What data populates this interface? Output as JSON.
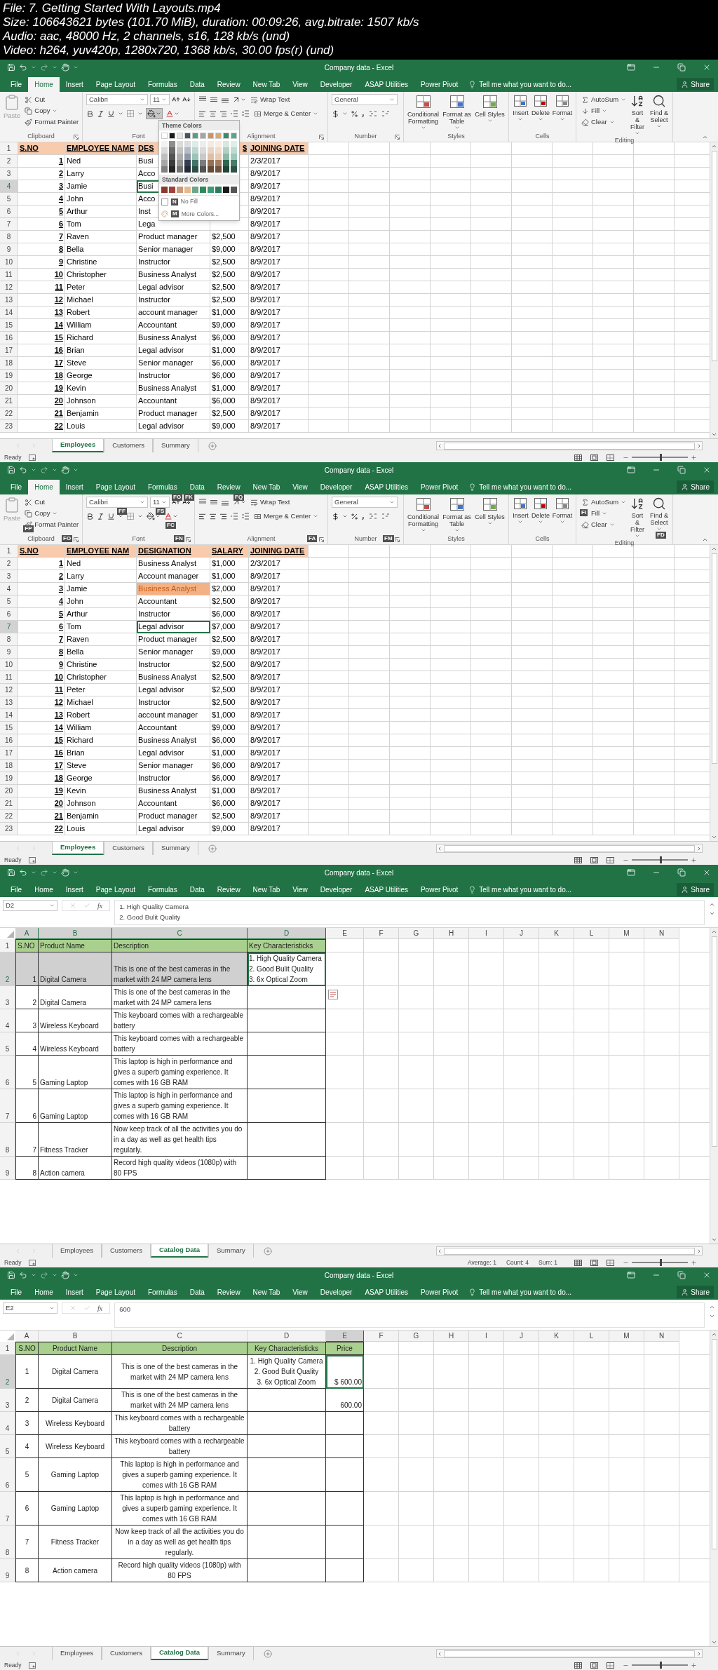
{
  "file_info": [
    "File: 7. Getting Started With Layouts.mp4",
    "Size: 106643621 bytes (101.70 MiB), duration: 00:09:26, avg.bitrate: 1507 kb/s",
    "Audio: aac, 48000 Hz, 2 channels, s16, 128 kb/s (und)",
    "Video: h264, yuv420p, 1280x720, 1368 kb/s, 30.00 fps(r) (und)"
  ],
  "frames": [
    {
      "title": "Company data - Excel",
      "menu_tabs": [
        {
          "label": "File",
          "selected": false
        },
        {
          "label": "Home",
          "selected": true
        },
        {
          "label": "Insert",
          "selected": false
        },
        {
          "label": "Page Layout",
          "selected": false
        },
        {
          "label": "Formulas",
          "selected": false
        },
        {
          "label": "Data",
          "selected": false
        },
        {
          "label": "Review",
          "selected": false
        },
        {
          "label": "New Tab",
          "selected": false
        },
        {
          "label": "View",
          "selected": false
        },
        {
          "label": "Developer",
          "selected": false
        },
        {
          "label": "ASAP Utilities",
          "selected": false
        },
        {
          "label": "Power Pivot",
          "selected": false
        }
      ],
      "tell_me": "Tell me what you want to do...",
      "share": "Share",
      "ribbon": {
        "paste": "Paste",
        "paste_disabled": true,
        "cut": "Cut",
        "copy": "Copy",
        "format_painter": "Format Painter",
        "clipboard": "Clipboard",
        "font_name": "Calibri",
        "font_size": "11",
        "font": "Font",
        "wrap_text": "Wrap Text",
        "merge_center": "Merge & Center",
        "alignment": "Alignment",
        "number_format": "General",
        "number": "Number",
        "styles_buttons": [
          "Conditional Formatting",
          "Format as Table",
          "Cell Styles"
        ],
        "styles": "Styles",
        "cells_buttons": [
          "Insert",
          "Delete",
          "Format"
        ],
        "cells": "Cells",
        "autosum": "AutoSum",
        "fill": "Fill",
        "clear": "Clear",
        "sort_filter": "Sort & Filter",
        "find_select": "Find & Select",
        "editing": "Editing"
      },
      "fill_menu": {
        "theme_title": "Theme Colors",
        "theme_colors": [
          {
            "color": "#ffffff"
          },
          {
            "color": "#1a1a1a"
          },
          {
            "color": "#e7e6e6"
          },
          {
            "color": "#44546a"
          },
          {
            "color": "#5b9b8a"
          },
          {
            "color": "#a5a5a5"
          },
          {
            "color": "#c8956b"
          },
          {
            "color": "#d9a77c"
          },
          {
            "color": "#3c8a6a"
          },
          {
            "color": "#5aa68a"
          }
        ],
        "standard_title": "Standard Colors",
        "standard_colors": [
          {
            "color": "#8b3a2e"
          },
          {
            "color": "#a0413a"
          },
          {
            "color": "#c89a78"
          },
          {
            "color": "#e6b98e"
          },
          {
            "color": "#6fa58a"
          },
          {
            "color": "#2e8b57"
          },
          {
            "color": "#3c9a78"
          },
          {
            "color": "#2d7a5c"
          },
          {
            "color": "#1a1a1a"
          },
          {
            "color": "#555555"
          }
        ],
        "no_fill": "No Fill",
        "no_fill_key": "N",
        "more_colors": "More Colors...",
        "more_colors_key": "M"
      },
      "sheet": {
        "kind": "employees",
        "rows": [
          {
            "number": "1",
            "selected": false,
            "cells": [
              "S.NO",
              "EMPLOYEE NAME",
              "DES",
              {
                "text": "$",
                "partly_covered": true
              },
              "JOINING DATE"
            ]
          },
          {
            "number": "2",
            "selected": false,
            "cells": [
              "1",
              "Ned",
              "Busi",
              null,
              "2/3/2017"
            ]
          },
          {
            "number": "3",
            "selected": false,
            "cells": [
              "2",
              "Larry",
              "Acco",
              null,
              "8/9/2017"
            ]
          },
          {
            "number": "4",
            "selected": true,
            "cells": [
              "3",
              "Jamie",
              {
                "text": "Busi",
                "selected": true
              },
              null,
              "8/9/2017"
            ]
          },
          {
            "number": "5",
            "selected": false,
            "cells": [
              "4",
              "John",
              "Acco",
              null,
              "8/9/2017"
            ]
          },
          {
            "number": "6",
            "selected": false,
            "cells": [
              "5",
              "Arthur",
              "Inst",
              null,
              "8/9/2017"
            ]
          },
          {
            "number": "7",
            "selected": false,
            "cells": [
              "6",
              "Tom",
              "Lega",
              null,
              "8/9/2017"
            ]
          },
          {
            "number": "8",
            "selected": false,
            "cells": [
              "7",
              "Raven",
              "Product manager",
              "$2,500",
              "8/9/2017"
            ]
          },
          {
            "number": "9",
            "selected": false,
            "cells": [
              "8",
              "Bella",
              "Senior manager",
              "$9,000",
              "8/9/2017"
            ]
          },
          {
            "number": "10",
            "selected": false,
            "cells": [
              "9",
              "Christine",
              "Instructor",
              "$2,500",
              "8/9/2017"
            ]
          },
          {
            "number": "11",
            "selected": false,
            "cells": [
              "10",
              "Christopher",
              "Business Analyst",
              "$2,500",
              "8/9/2017"
            ]
          },
          {
            "number": "12",
            "selected": false,
            "cells": [
              "11",
              "Peter",
              "Legal advisor",
              "$2,500",
              "8/9/2017"
            ]
          },
          {
            "number": "13",
            "selected": false,
            "cells": [
              "12",
              "Michael",
              "Instructor",
              "$2,500",
              "8/9/2017"
            ]
          },
          {
            "number": "14",
            "selected": false,
            "cells": [
              "13",
              "Robert",
              "account manager",
              "$1,000",
              "8/9/2017"
            ]
          },
          {
            "number": "15",
            "selected": false,
            "cells": [
              "14",
              "William",
              "Accountant",
              "$9,000",
              "8/9/2017"
            ]
          },
          {
            "number": "16",
            "selected": false,
            "cells": [
              "15",
              "Richard",
              "Business Analyst",
              "$6,000",
              "8/9/2017"
            ]
          },
          {
            "number": "17",
            "selected": false,
            "cells": [
              "16",
              "Brian",
              "Legal advisor",
              "$1,000",
              "8/9/2017"
            ]
          },
          {
            "number": "18",
            "selected": false,
            "cells": [
              "17",
              "Steve",
              "Senior manager",
              "$6,000",
              "8/9/2017"
            ]
          },
          {
            "number": "19",
            "selected": false,
            "cells": [
              "18",
              "George",
              "Instructor",
              "$6,000",
              "8/9/2017"
            ]
          },
          {
            "number": "20",
            "selected": false,
            "cells": [
              "19",
              "Kevin",
              "Business Analyst",
              "$1,000",
              "8/9/2017"
            ]
          },
          {
            "number": "21",
            "selected": false,
            "cells": [
              "20",
              "Johnson",
              "Accountant",
              "$6,000",
              "8/9/2017"
            ]
          },
          {
            "number": "22",
            "selected": false,
            "cells": [
              "21",
              "Benjamin",
              "Product manager",
              "$2,500",
              "8/9/2017"
            ]
          },
          {
            "number": "23",
            "selected": false,
            "cells": [
              "22",
              "Louis",
              "Legal advisor",
              "$9,000",
              "8/9/2017"
            ]
          }
        ]
      },
      "sheet_tabs": [
        {
          "label": "Employees",
          "selected": true
        },
        {
          "label": "Customers",
          "selected": false
        },
        {
          "label": "Summary",
          "selected": false
        }
      ],
      "status": {
        "text": "Ready",
        "zoom": {
          "level": 0.5
        }
      }
    },
    {
      "title": "Company data - Excel",
      "menu_tabs": [
        {
          "label": "File",
          "selected": false
        },
        {
          "label": "Home",
          "selected": true
        },
        {
          "label": "Insert",
          "selected": false
        },
        {
          "label": "Page Layout",
          "selected": false
        },
        {
          "label": "Formulas",
          "selected": false
        },
        {
          "label": "Data",
          "selected": false
        },
        {
          "label": "Review",
          "selected": false
        },
        {
          "label": "New Tab",
          "selected": false
        },
        {
          "label": "View",
          "selected": false
        },
        {
          "label": "Developer",
          "selected": false
        },
        {
          "label": "ASAP Utilities",
          "selected": false
        },
        {
          "label": "Power Pivot",
          "selected": false
        }
      ],
      "tell_me": "Tell me what you want to do...",
      "share": "Share",
      "ribbon": {
        "paste": "Paste",
        "paste_disabled": true,
        "cut": "Cut",
        "copy": "Copy",
        "format_painter": "Format Painter",
        "clipboard": "Clipboard",
        "font_name": "Calibri",
        "font_size": "11",
        "font": "Font",
        "wrap_text": "Wrap Text",
        "merge_center": "Merge & Center",
        "alignment": "Alignment",
        "number_format": "General",
        "number": "Number",
        "styles_buttons": [
          "Conditional Formatting",
          "Format as Table",
          "Cell Styles"
        ],
        "styles": "Styles",
        "cells_buttons": [
          "Insert",
          "Delete",
          "Format"
        ],
        "cells": "Cells",
        "autosum": "AutoSum",
        "fill": "Fill",
        "clear": "Clear",
        "sort_filter": "Sort & Filter",
        "find_select": "Find & Select",
        "editing": "Editing"
      },
      "keytips": {
        "font_name": "FF",
        "font_size": "FS",
        "grow_font": "FG",
        "shrink_font": "FK",
        "orientation": "FQ",
        "format_painter": "FP",
        "clipboard_launcher": "FO",
        "font_color": "FC",
        "font_launcher": "FN",
        "alignment_launcher": "FA",
        "number_launcher": "FM",
        "fill": "FI",
        "find_select": "FD"
      },
      "sheet": {
        "kind": "employees",
        "rows": [
          {
            "number": "1",
            "selected": false,
            "cells": [
              "S.NO",
              "EMPLOYEE NAM",
              "DESIGNATION",
              "SALARY",
              "JOINING DATE"
            ]
          },
          {
            "number": "2",
            "selected": false,
            "cells": [
              "1",
              "Ned",
              "Business Analyst",
              "$1,000",
              "2/3/2017"
            ]
          },
          {
            "number": "3",
            "selected": false,
            "cells": [
              "2",
              "Larry",
              "Account manager",
              "$1,000",
              "8/9/2017"
            ]
          },
          {
            "number": "4",
            "selected": false,
            "cells": [
              "3",
              "Jamie",
              {
                "text": "Business Analyst",
                "highlighted": true
              },
              "$2,000",
              "8/9/2017"
            ]
          },
          {
            "number": "5",
            "selected": false,
            "cells": [
              "4",
              "John",
              "Accountant",
              "$2,500",
              "8/9/2017"
            ]
          },
          {
            "number": "6",
            "selected": false,
            "cells": [
              "5",
              "Arthur",
              "Instructor",
              "$6,000",
              "8/9/2017"
            ]
          },
          {
            "number": "7",
            "selected": true,
            "cells": [
              "6",
              "Tom",
              {
                "text": "Legal advisor",
                "selected": true
              },
              "$7,000",
              "8/9/2017"
            ]
          },
          {
            "number": "8",
            "selected": false,
            "cells": [
              "7",
              "Raven",
              "Product manager",
              "$2,500",
              "8/9/2017"
            ]
          },
          {
            "number": "9",
            "selected": false,
            "cells": [
              "8",
              "Bella",
              "Senior manager",
              "$9,000",
              "8/9/2017"
            ]
          },
          {
            "number": "10",
            "selected": false,
            "cells": [
              "9",
              "Christine",
              "Instructor",
              "$2,500",
              "8/9/2017"
            ]
          },
          {
            "number": "11",
            "selected": false,
            "cells": [
              "10",
              "Christopher",
              "Business Analyst",
              "$2,500",
              "8/9/2017"
            ]
          },
          {
            "number": "12",
            "selected": false,
            "cells": [
              "11",
              "Peter",
              "Legal advisor",
              "$2,500",
              "8/9/2017"
            ]
          },
          {
            "number": "13",
            "selected": false,
            "cells": [
              "12",
              "Michael",
              "Instructor",
              "$2,500",
              "8/9/2017"
            ]
          },
          {
            "number": "14",
            "selected": false,
            "cells": [
              "13",
              "Robert",
              "account manager",
              "$1,000",
              "8/9/2017"
            ]
          },
          {
            "number": "15",
            "selected": false,
            "cells": [
              "14",
              "William",
              "Accountant",
              "$9,000",
              "8/9/2017"
            ]
          },
          {
            "number": "16",
            "selected": false,
            "cells": [
              "15",
              "Richard",
              "Business Analyst",
              "$6,000",
              "8/9/2017"
            ]
          },
          {
            "number": "17",
            "selected": false,
            "cells": [
              "16",
              "Brian",
              "Legal advisor",
              "$1,000",
              "8/9/2017"
            ]
          },
          {
            "number": "18",
            "selected": false,
            "cells": [
              "17",
              "Steve",
              "Senior manager",
              "$6,000",
              "8/9/2017"
            ]
          },
          {
            "number": "19",
            "selected": false,
            "cells": [
              "18",
              "George",
              "Instructor",
              "$6,000",
              "8/9/2017"
            ]
          },
          {
            "number": "20",
            "selected": false,
            "cells": [
              "19",
              "Kevin",
              "Business Analyst",
              "$1,000",
              "8/9/2017"
            ]
          },
          {
            "number": "21",
            "selected": false,
            "cells": [
              "20",
              "Johnson",
              "Accountant",
              "$6,000",
              "8/9/2017"
            ]
          },
          {
            "number": "22",
            "selected": false,
            "cells": [
              "21",
              "Benjamin",
              "Product manager",
              "$2,500",
              "8/9/2017"
            ]
          },
          {
            "number": "23",
            "selected": false,
            "cells": [
              "22",
              "Louis",
              "Legal advisor",
              "$9,000",
              "8/9/2017"
            ]
          }
        ]
      },
      "sheet_tabs": [
        {
          "label": "Employees",
          "selected": true
        },
        {
          "label": "Customers",
          "selected": false
        },
        {
          "label": "Summary",
          "selected": false
        }
      ],
      "status": {
        "text": "Ready",
        "zoom": {
          "level": 0.5
        }
      }
    },
    {
      "title": "Company data - Excel",
      "menu_tabs": [
        {
          "label": "File",
          "selected": false
        },
        {
          "label": "Home",
          "selected": false
        },
        {
          "label": "Insert",
          "selected": false
        },
        {
          "label": "Page Layout",
          "selected": false
        },
        {
          "label": "Formulas",
          "selected": false
        },
        {
          "label": "Data",
          "selected": false
        },
        {
          "label": "Review",
          "selected": false
        },
        {
          "label": "New Tab",
          "selected": false
        },
        {
          "label": "View",
          "selected": false
        },
        {
          "label": "Developer",
          "selected": false
        },
        {
          "label": "ASAP Utilities",
          "selected": false
        },
        {
          "label": "Power Pivot",
          "selected": false
        }
      ],
      "tell_me": "Tell me what you want to do...",
      "share": "Share",
      "formula_bar": {
        "name_box": "D2",
        "function_label": "fx",
        "content": "1. High Quality Camera\n2. Good Bulit Quality"
      },
      "sheet": {
        "kind": "catalog",
        "centered": false,
        "quick_analysis": true,
        "column_headers": [
          {
            "label": "A",
            "selected": true
          },
          {
            "label": "B",
            "selected": true
          },
          {
            "label": "C",
            "selected": true
          },
          {
            "label": "D",
            "selected": true
          },
          {
            "label": "E",
            "selected": false
          },
          {
            "label": "F",
            "selected": false
          },
          {
            "label": "G",
            "selected": false
          },
          {
            "label": "H",
            "selected": false
          },
          {
            "label": "I",
            "selected": false
          },
          {
            "label": "J",
            "selected": false
          },
          {
            "label": "K",
            "selected": false
          },
          {
            "label": "L",
            "selected": false
          },
          {
            "label": "M",
            "selected": false
          },
          {
            "label": "N",
            "selected": false
          }
        ],
        "rows": [
          {
            "number": "1",
            "selected": false,
            "cells": [
              "S.NO",
              "Product Name",
              "Description",
              "Key Characteristicks"
            ]
          },
          {
            "number": "2",
            "selected": true,
            "cells": [
              {
                "text": "1",
                "highlighted": true
              },
              {
                "text": "Digital Camera",
                "highlighted": true
              },
              {
                "text": "This is one of the best cameras in the market with 24 MP camera lens",
                "highlighted": true
              },
              {
                "text": "1. High Quality Camera\n2. Good Bulit Quality\n3. 6x Optical Zoom",
                "selected": true
              }
            ]
          },
          {
            "number": "3",
            "selected": false,
            "cells": [
              "2",
              "Digital Camera",
              "This is one of the best cameras in the market with 24 MP camera lens"
            ]
          },
          {
            "number": "4",
            "selected": false,
            "cells": [
              "3",
              "Wireless Keyboard",
              "This keyboard comes with a rechargeable battery"
            ]
          },
          {
            "number": "5",
            "selected": false,
            "cells": [
              "4",
              "Wireless Keyboard",
              "This keyboard comes with a rechargeable battery"
            ]
          },
          {
            "number": "6",
            "selected": false,
            "cells": [
              "5",
              "Gaming Laptop",
              "This laptop is high in performance and gives a superb gaming experience. It comes with 16 GB RAM"
            ]
          },
          {
            "number": "7",
            "selected": false,
            "cells": [
              "6",
              "Gaming Laptop",
              "This laptop is high in performance and gives a superb gaming experience. It comes with 16 GB RAM"
            ]
          },
          {
            "number": "8",
            "selected": false,
            "cells": [
              "7",
              "Fitness Tracker",
              "Now keep track of all the activities you do in a day as well as get health tips regularly."
            ]
          },
          {
            "number": "9",
            "selected": false,
            "cells": [
              "8",
              "Action camera",
              "Record high quality videos (1080p) with 80 FPS"
            ]
          }
        ]
      },
      "sheet_tabs": [
        {
          "label": "Employees",
          "selected": false
        },
        {
          "label": "Customers",
          "selected": false
        },
        {
          "label": "Catalog Data",
          "selected": true
        },
        {
          "label": "Summary",
          "selected": false
        }
      ],
      "status": {
        "text": "Ready",
        "stats": [
          "Average: 1",
          "Count: 4",
          "Sum: 1"
        ],
        "zoom": {
          "level": 0.5
        }
      }
    },
    {
      "title": "Company data - Excel",
      "menu_tabs": [
        {
          "label": "File",
          "selected": false
        },
        {
          "label": "Home",
          "selected": false
        },
        {
          "label": "Insert",
          "selected": false
        },
        {
          "label": "Page Layout",
          "selected": false
        },
        {
          "label": "Formulas",
          "selected": false
        },
        {
          "label": "Data",
          "selected": false
        },
        {
          "label": "Review",
          "selected": false
        },
        {
          "label": "New Tab",
          "selected": false
        },
        {
          "label": "View",
          "selected": false
        },
        {
          "label": "Developer",
          "selected": false
        },
        {
          "label": "ASAP Utilities",
          "selected": false
        },
        {
          "label": "Power Pivot",
          "selected": false
        }
      ],
      "tell_me": "Tell me what you want to do...",
      "share": "Share",
      "formula_bar": {
        "name_box": "E2",
        "function_label": "fx",
        "content": "600"
      },
      "sheet": {
        "kind": "catalog",
        "centered": true,
        "column_headers": [
          {
            "label": "A",
            "selected": false
          },
          {
            "label": "B",
            "selected": false
          },
          {
            "label": "C",
            "selected": false
          },
          {
            "label": "D",
            "selected": false
          },
          {
            "label": "E",
            "selected": true
          },
          {
            "label": "F",
            "selected": false
          },
          {
            "label": "G",
            "selected": false
          },
          {
            "label": "H",
            "selected": false
          },
          {
            "label": "I",
            "selected": false
          },
          {
            "label": "J",
            "selected": false
          },
          {
            "label": "K",
            "selected": false
          },
          {
            "label": "L",
            "selected": false
          },
          {
            "label": "M",
            "selected": false
          },
          {
            "label": "N",
            "selected": false
          }
        ],
        "rows": [
          {
            "number": "1",
            "selected": false,
            "cells": [
              "S.NO",
              "Product Name",
              "Description",
              "Key Characteristicks",
              "Price"
            ]
          },
          {
            "number": "2",
            "selected": true,
            "cells": [
              "1",
              "Digital Camera",
              "This is one of the best cameras in the market with 24 MP camera lens",
              "1. High Quality Camera\n2. Good Bulit Quality\n3. 6x Optical Zoom",
              {
                "text": "$ 600.00",
                "selected": true
              }
            ]
          },
          {
            "number": "3",
            "selected": false,
            "cells": [
              "2",
              "Digital Camera",
              "This is one of the best cameras in the market with 24 MP camera lens",
              null,
              "600.00"
            ]
          },
          {
            "number": "4",
            "selected": false,
            "cells": [
              "3",
              "Wireless Keyboard",
              "This keyboard comes with a rechargeable battery"
            ]
          },
          {
            "number": "5",
            "selected": false,
            "cells": [
              "4",
              "Wireless Keyboard",
              "This keyboard comes with a rechargeable battery"
            ]
          },
          {
            "number": "6",
            "selected": false,
            "cells": [
              "5",
              "Gaming Laptop",
              "This laptop is high in performance and gives a superb gaming experience. It comes with 16 GB RAM"
            ]
          },
          {
            "number": "7",
            "selected": false,
            "cells": [
              "6",
              "Gaming Laptop",
              "This laptop is high in performance and gives a superb gaming experience. It comes with 16 GB RAM"
            ]
          },
          {
            "number": "8",
            "selected": false,
            "cells": [
              "7",
              "Fitness Tracker",
              "Now keep track of all the activities you do in a day as well as get health tips regularly."
            ]
          },
          {
            "number": "9",
            "selected": false,
            "cells": [
              "8",
              "Action camera",
              "Record high quality videos (1080p) with 80 FPS"
            ]
          }
        ]
      },
      "sheet_tabs": [
        {
          "label": "Employees",
          "selected": false
        },
        {
          "label": "Customers",
          "selected": false
        },
        {
          "label": "Catalog Data",
          "selected": true
        },
        {
          "label": "Summary",
          "selected": false
        }
      ],
      "status": {
        "text": "Ready",
        "zoom": {
          "level": 0.5
        }
      }
    }
  ]
}
